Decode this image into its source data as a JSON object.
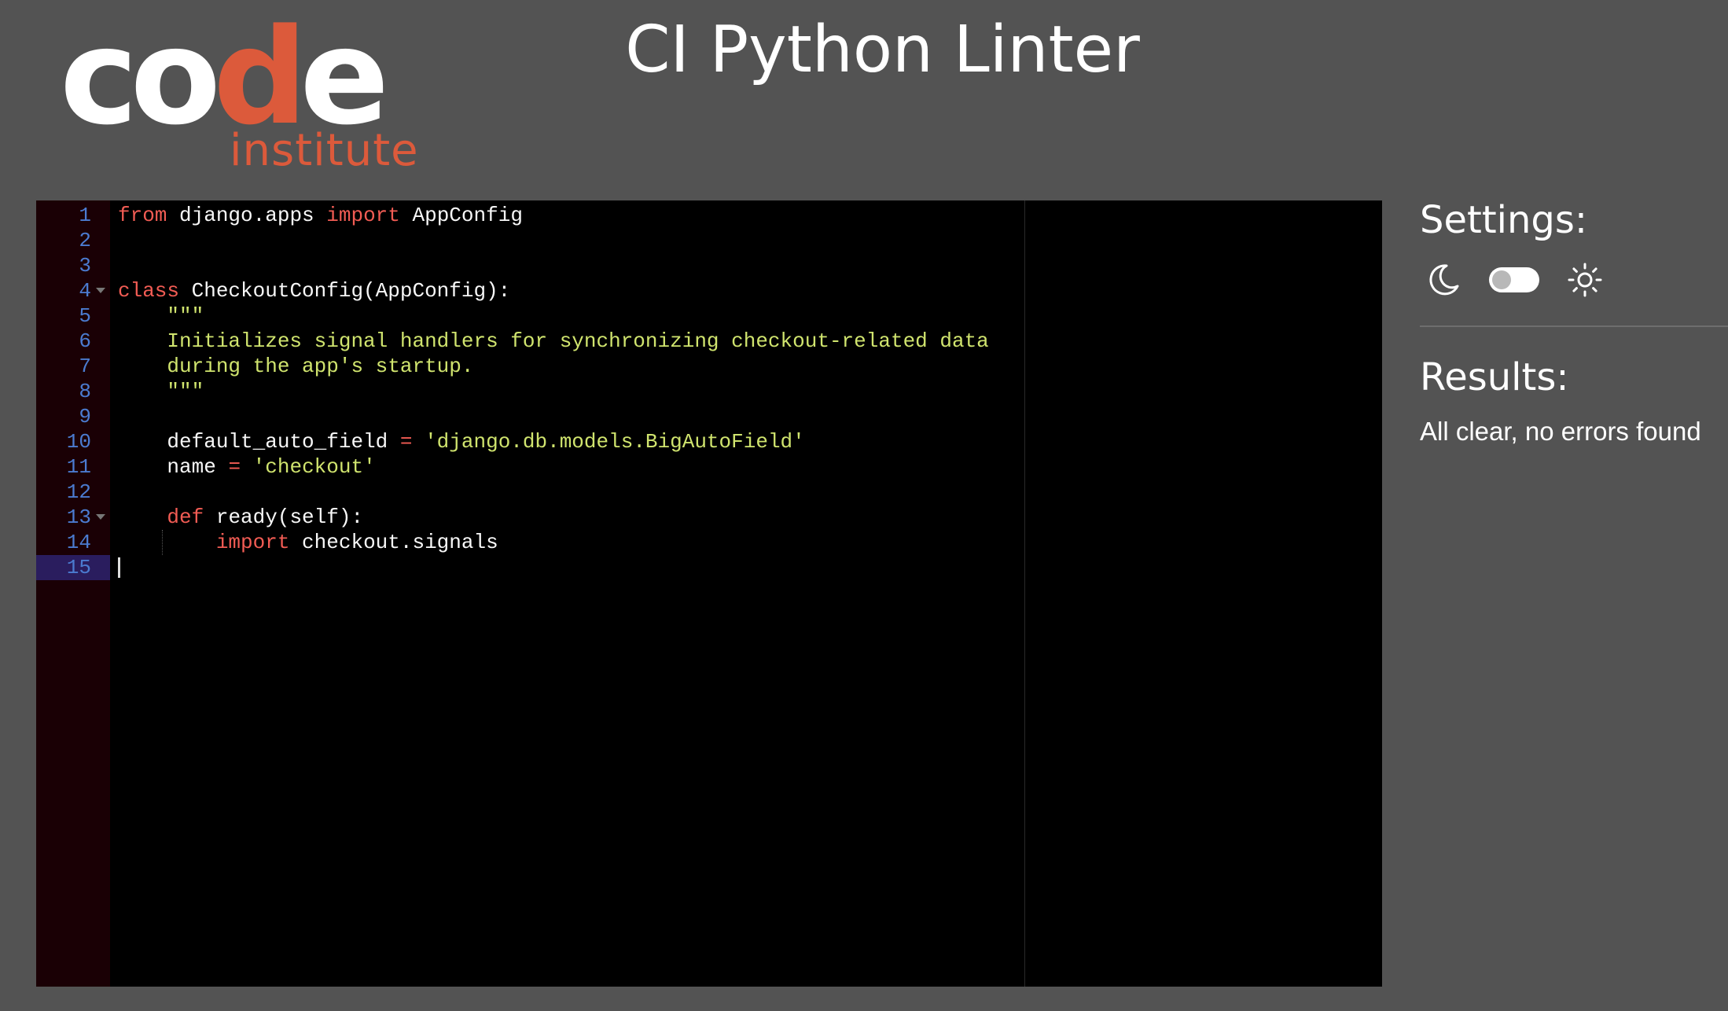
{
  "header": {
    "logo_word_part1": "co",
    "logo_word_accent": "d",
    "logo_word_part2": "e",
    "logo_subtext": "institute",
    "title": "CI Python Linter"
  },
  "editor": {
    "active_line": 15,
    "lines": [
      {
        "n": "1",
        "tokens": [
          {
            "t": "from",
            "c": "kw"
          },
          {
            "t": " django.apps ",
            "c": "id"
          },
          {
            "t": "import",
            "c": "kw"
          },
          {
            "t": " AppConfig",
            "c": "id"
          }
        ]
      },
      {
        "n": "2",
        "tokens": []
      },
      {
        "n": "3",
        "tokens": []
      },
      {
        "n": "4",
        "fold": true,
        "tokens": [
          {
            "t": "class",
            "c": "kw"
          },
          {
            "t": " CheckoutConfig(AppConfig):",
            "c": "id"
          }
        ]
      },
      {
        "n": "5",
        "tokens": [
          {
            "t": "    \"\"\"",
            "c": "doc"
          }
        ]
      },
      {
        "n": "6",
        "tokens": [
          {
            "t": "    Initializes signal handlers for synchronizing checkout-related data",
            "c": "doc"
          }
        ]
      },
      {
        "n": "7",
        "tokens": [
          {
            "t": "    during the app's startup.",
            "c": "doc"
          }
        ]
      },
      {
        "n": "8",
        "tokens": [
          {
            "t": "    \"\"\"",
            "c": "doc"
          }
        ]
      },
      {
        "n": "9",
        "tokens": []
      },
      {
        "n": "10",
        "tokens": [
          {
            "t": "    default_auto_field ",
            "c": "id"
          },
          {
            "t": "=",
            "c": "op"
          },
          {
            "t": " ",
            "c": "id"
          },
          {
            "t": "'django.db.models.BigAutoField'",
            "c": "str"
          }
        ]
      },
      {
        "n": "11",
        "tokens": [
          {
            "t": "    name ",
            "c": "id"
          },
          {
            "t": "=",
            "c": "op"
          },
          {
            "t": " ",
            "c": "id"
          },
          {
            "t": "'checkout'",
            "c": "str"
          }
        ]
      },
      {
        "n": "12",
        "tokens": []
      },
      {
        "n": "13",
        "fold": true,
        "tokens": [
          {
            "t": "    ",
            "c": "id"
          },
          {
            "t": "def",
            "c": "kw"
          },
          {
            "t": " ready(self):",
            "c": "id"
          }
        ]
      },
      {
        "n": "14",
        "guide": true,
        "tokens": [
          {
            "t": "        ",
            "c": "id"
          },
          {
            "t": "import",
            "c": "kw"
          },
          {
            "t": " checkout.signals",
            "c": "id"
          }
        ]
      },
      {
        "n": "15",
        "tokens": []
      }
    ]
  },
  "settings": {
    "title": "Settings:",
    "dark_icon": "moon-icon",
    "light_icon": "sun-icon",
    "theme_light": false
  },
  "results": {
    "title": "Results:",
    "message": "All clear, no errors found"
  }
}
